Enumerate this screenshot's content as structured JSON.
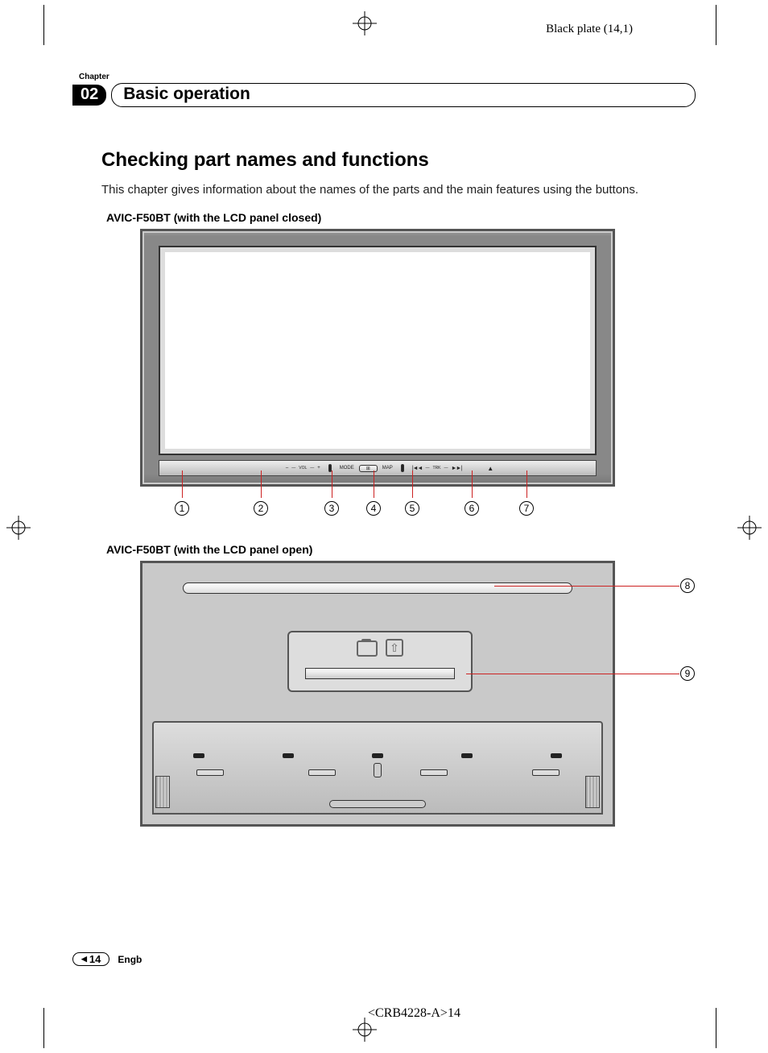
{
  "plate_label": "Black plate (14,1)",
  "chapter_word": "Chapter",
  "chapter_number": "02",
  "chapter_title": "Basic operation",
  "section_title": "Checking part names and functions",
  "intro_text": "This chapter gives information about the names of the parts and the main features using the buttons.",
  "device_closed_label_prefix": "AVIC-F50BT ",
  "device_closed_label_suffix": "(with the LCD panel closed)",
  "device_open_label_prefix": "AVIC-F50BT ",
  "device_open_label_suffix": "(with the LCD panel open)",
  "buttonbar": {
    "minus": "–",
    "vol": "VOL",
    "plus": "+",
    "mode": "MODE",
    "map": "MAP",
    "trk_prev": "|◄◄",
    "trk": "TRK",
    "trk_next": "►►|",
    "eject": "▲"
  },
  "callouts_bottom": [
    "1",
    "2",
    "3",
    "4",
    "5",
    "6",
    "7"
  ],
  "callouts_side": [
    "8",
    "9"
  ],
  "footer": {
    "page_number": "14",
    "lang": "Engb"
  },
  "doc_id": "<CRB4228-A>14"
}
